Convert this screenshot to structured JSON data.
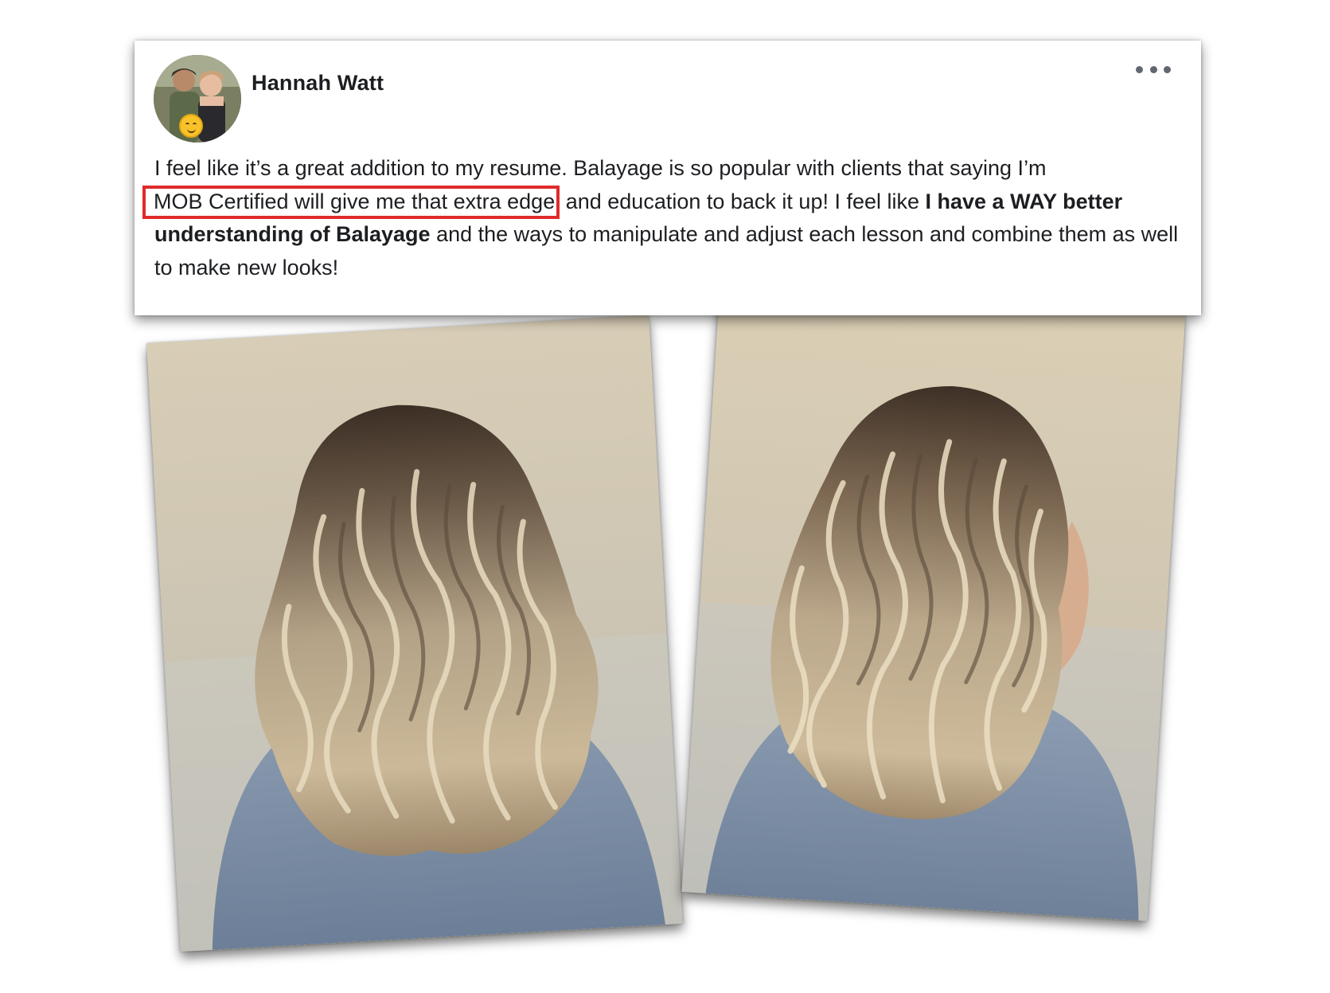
{
  "post": {
    "author_name": "Hannah Watt",
    "avatar_icon": "profile-photo-icon",
    "avatar_badge_icon": "smiling-emoji-icon",
    "more_icon": "three-dots-icon",
    "text": {
      "line1": "I feel like it’s a great addition to my resume. Balayage is so popular with clients that saying I’m",
      "highlighted_phrase": "MOB Certified will give me that extra edge",
      "after_highlight": " and education to back it up! I feel like ",
      "bold_phrase": "I have a WAY better understanding of Balayage",
      "ending": " and the ways to manipulate and adjust each lesson and combine them as well to make new looks!"
    },
    "highlight_color": "#e02b2b"
  },
  "photos": [
    {
      "subject": "balayage-hair-back-view"
    },
    {
      "subject": "balayage-hair-side-view"
    }
  ]
}
